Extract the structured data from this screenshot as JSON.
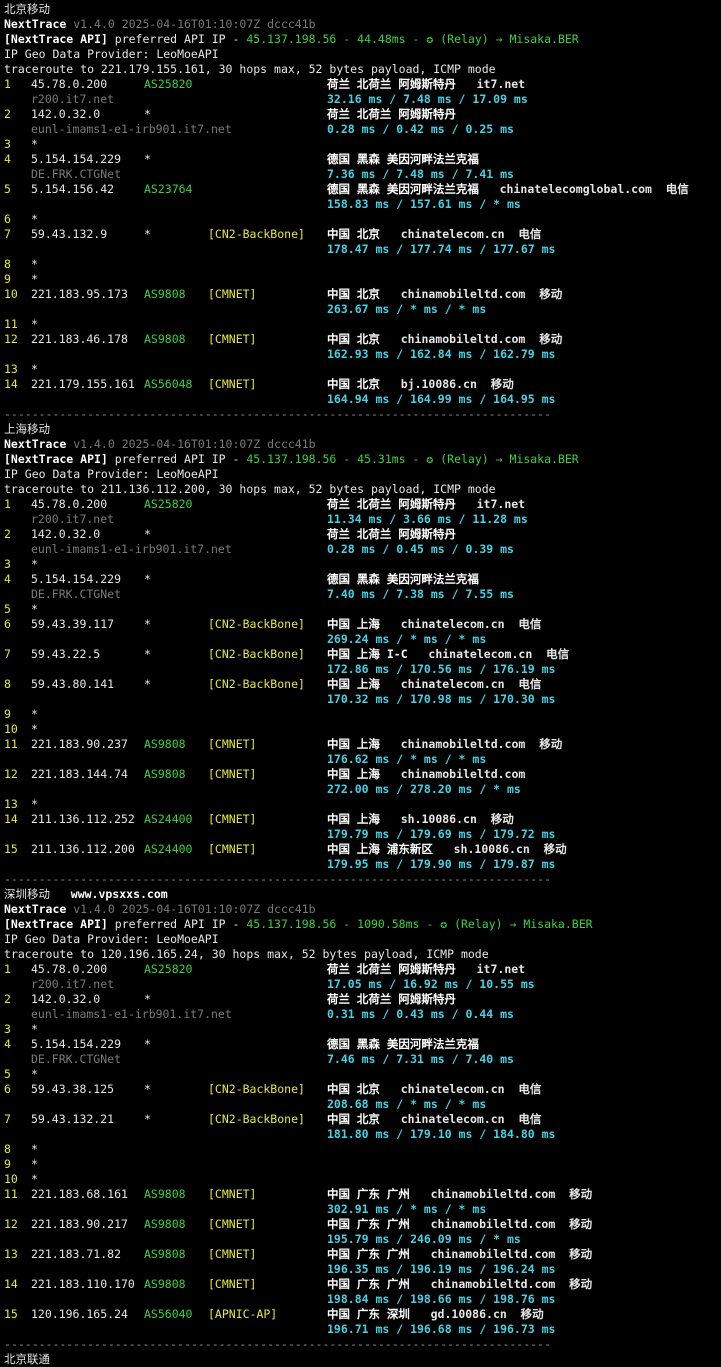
{
  "arrow": "→",
  "sections": [
    {
      "title": "北京移动",
      "header": {
        "app": "NextTrace",
        "version": "v1.4.0 2025-04-16T01:10:07Z dccc41b",
        "api_tag": "[NextTrace API]",
        "api_text": " preferred API IP - ",
        "api_ip": "45.137.198.56",
        "api_latency": "44.48ms",
        "relay_icon": "✪",
        "relay_text": "(Relay)",
        "relay_target": "Misaka.BER",
        "provider": "IP Geo Data Provider: LeoMoeAPI",
        "traceroute": "traceroute to 221.179.155.161, 30 hops max, 52 bytes payload, ICMP mode"
      },
      "hops": [
        {
          "n": "1",
          "ip": "45.78.0.200",
          "asn": "AS25820",
          "tag": "",
          "geo": "荷兰 北荷兰 阿姆斯特丹",
          "domain": "it7.net",
          "isp": "",
          "rdns": "r200.it7.net",
          "times": "32.16 ms / 7.48 ms / 17.09 ms"
        },
        {
          "n": "2",
          "ip": "142.0.32.0",
          "asn": "*",
          "tag": "",
          "geo": "荷兰 北荷兰 阿姆斯特丹",
          "domain": "",
          "isp": "",
          "rdns": "eunl-imams1-e1-irb901.it7.net",
          "times": "0.28 ms / 0.42 ms / 0.25 ms"
        },
        {
          "n": "3",
          "ip": "*",
          "asn": "",
          "tag": "",
          "geo": "",
          "domain": "",
          "isp": "",
          "rdns": "",
          "times": ""
        },
        {
          "n": "4",
          "ip": "5.154.154.229",
          "asn": "*",
          "tag": "",
          "geo": "德国 黑森 美因河畔法兰克福",
          "domain": "",
          "isp": "",
          "rdns": "DE.FRK.CTGNet",
          "times": "7.36 ms / 7.48 ms / 7.41 ms"
        },
        {
          "n": "5",
          "ip": "5.154.156.42",
          "asn": "AS23764",
          "tag": "",
          "geo": "德国 黑森 美因河畔法兰克福",
          "domain": "chinatelecomglobal.com",
          "isp": "电信",
          "rdns": "",
          "times": "158.83 ms / 157.61 ms / * ms"
        },
        {
          "n": "6",
          "ip": "*",
          "asn": "",
          "tag": "",
          "geo": "",
          "domain": "",
          "isp": "",
          "rdns": "",
          "times": ""
        },
        {
          "n": "7",
          "ip": "59.43.132.9",
          "asn": "*",
          "tag": "[CN2-BackBone]",
          "geo": "中国 北京",
          "domain": "chinatelecom.cn",
          "isp": "电信",
          "rdns": "",
          "times": "178.47 ms / 177.74 ms / 177.67 ms"
        },
        {
          "n": "8",
          "ip": "*",
          "asn": "",
          "tag": "",
          "geo": "",
          "domain": "",
          "isp": "",
          "rdns": "",
          "times": ""
        },
        {
          "n": "9",
          "ip": "*",
          "asn": "",
          "tag": "",
          "geo": "",
          "domain": "",
          "isp": "",
          "rdns": "",
          "times": ""
        },
        {
          "n": "10",
          "ip": "221.183.95.173",
          "asn": "AS9808",
          "tag": "[CMNET]",
          "geo": "中国 北京",
          "domain": "chinamobileltd.com",
          "isp": "移动",
          "rdns": "",
          "times": "263.67 ms / * ms / * ms"
        },
        {
          "n": "11",
          "ip": "*",
          "asn": "",
          "tag": "",
          "geo": "",
          "domain": "",
          "isp": "",
          "rdns": "",
          "times": ""
        },
        {
          "n": "12",
          "ip": "221.183.46.178",
          "asn": "AS9808",
          "tag": "[CMNET]",
          "geo": "中国 北京",
          "domain": "chinamobileltd.com",
          "isp": "移动",
          "rdns": "",
          "times": "162.93 ms / 162.84 ms / 162.79 ms"
        },
        {
          "n": "13",
          "ip": "*",
          "asn": "",
          "tag": "",
          "geo": "",
          "domain": "",
          "isp": "",
          "rdns": "",
          "times": ""
        },
        {
          "n": "14",
          "ip": "221.179.155.161",
          "asn": "AS56048",
          "tag": "[CMNET]",
          "geo": "中国 北京",
          "domain": "bj.10086.cn",
          "isp": "移动",
          "rdns": "",
          "times": "164.94 ms / 164.99 ms / 164.95 ms"
        }
      ]
    },
    {
      "title": "上海移动",
      "header": {
        "app": "NextTrace",
        "version": "v1.4.0 2025-04-16T01:10:07Z dccc41b",
        "api_tag": "[NextTrace API]",
        "api_text": " preferred API IP - ",
        "api_ip": "45.137.198.56",
        "api_latency": "45.31ms",
        "relay_icon": "✪",
        "relay_text": "(Relay)",
        "relay_target": "Misaka.BER",
        "provider": "IP Geo Data Provider: LeoMoeAPI",
        "traceroute": "traceroute to 211.136.112.200, 30 hops max, 52 bytes payload, ICMP mode"
      },
      "hops": [
        {
          "n": "1",
          "ip": "45.78.0.200",
          "asn": "AS25820",
          "tag": "",
          "geo": "荷兰 北荷兰 阿姆斯特丹",
          "domain": "it7.net",
          "isp": "",
          "rdns": "r200.it7.net",
          "times": "11.34 ms / 3.66 ms / 11.28 ms"
        },
        {
          "n": "2",
          "ip": "142.0.32.0",
          "asn": "*",
          "tag": "",
          "geo": "荷兰 北荷兰 阿姆斯特丹",
          "domain": "",
          "isp": "",
          "rdns": "eunl-imams1-e1-irb901.it7.net",
          "times": "0.28 ms / 0.45 ms / 0.39 ms"
        },
        {
          "n": "3",
          "ip": "*",
          "asn": "",
          "tag": "",
          "geo": "",
          "domain": "",
          "isp": "",
          "rdns": "",
          "times": ""
        },
        {
          "n": "4",
          "ip": "5.154.154.229",
          "asn": "*",
          "tag": "",
          "geo": "德国 黑森 美因河畔法兰克福",
          "domain": "",
          "isp": "",
          "rdns": "DE.FRK.CTGNet",
          "times": "7.40 ms / 7.38 ms / 7.55 ms"
        },
        {
          "n": "5",
          "ip": "*",
          "asn": "",
          "tag": "",
          "geo": "",
          "domain": "",
          "isp": "",
          "rdns": "",
          "times": ""
        },
        {
          "n": "6",
          "ip": "59.43.39.117",
          "asn": "*",
          "tag": "[CN2-BackBone]",
          "geo": "中国 上海",
          "domain": "chinatelecom.cn",
          "isp": "电信",
          "rdns": "",
          "times": "269.24 ms / * ms / * ms"
        },
        {
          "n": "7",
          "ip": "59.43.22.5",
          "asn": "*",
          "tag": "[CN2-BackBone]",
          "geo": "中国 上海 I-C",
          "domain": "chinatelecom.cn",
          "isp": "电信",
          "rdns": "",
          "times": "172.86 ms / 170.56 ms / 176.19 ms"
        },
        {
          "n": "8",
          "ip": "59.43.80.141",
          "asn": "*",
          "tag": "[CN2-BackBone]",
          "geo": "中国 上海",
          "domain": "chinatelecom.cn",
          "isp": "电信",
          "rdns": "",
          "times": "170.32 ms / 170.98 ms / 170.30 ms"
        },
        {
          "n": "9",
          "ip": "*",
          "asn": "",
          "tag": "",
          "geo": "",
          "domain": "",
          "isp": "",
          "rdns": "",
          "times": ""
        },
        {
          "n": "10",
          "ip": "*",
          "asn": "",
          "tag": "",
          "geo": "",
          "domain": "",
          "isp": "",
          "rdns": "",
          "times": ""
        },
        {
          "n": "11",
          "ip": "221.183.90.237",
          "asn": "AS9808",
          "tag": "[CMNET]",
          "geo": "中国 上海",
          "domain": "chinamobileltd.com",
          "isp": "移动",
          "rdns": "",
          "times": "176.62 ms / * ms / * ms"
        },
        {
          "n": "12",
          "ip": "221.183.144.74",
          "asn": "AS9808",
          "tag": "[CMNET]",
          "geo": "中国 上海",
          "domain": "chinamobileltd.com",
          "isp": "",
          "rdns": "",
          "times": "272.00 ms / 278.20 ms / * ms"
        },
        {
          "n": "13",
          "ip": "*",
          "asn": "",
          "tag": "",
          "geo": "",
          "domain": "",
          "isp": "",
          "rdns": "",
          "times": ""
        },
        {
          "n": "14",
          "ip": "211.136.112.252",
          "asn": "AS24400",
          "tag": "[CMNET]",
          "geo": "中国 上海",
          "domain": "sh.10086.cn",
          "isp": "移动",
          "rdns": "",
          "times": "179.79 ms / 179.69 ms / 179.72 ms"
        },
        {
          "n": "15",
          "ip": "211.136.112.200",
          "asn": "AS24400",
          "tag": "[CMNET]",
          "geo": "中国 上海 浦东新区",
          "domain": "sh.10086.cn",
          "isp": "移动",
          "rdns": "",
          "times": "179.95 ms / 179.90 ms / 179.87 ms"
        }
      ]
    },
    {
      "title": "深圳移动",
      "watermark": "www.vpsxxs.com",
      "header": {
        "app": "NextTrace",
        "version": "v1.4.0 2025-04-16T01:10:07Z dccc41b",
        "api_tag": "[NextTrace API]",
        "api_text": " preferred API IP - ",
        "api_ip": "45.137.198.56",
        "api_latency": "1090.58ms",
        "relay_icon": "✪",
        "relay_text": "(Relay)",
        "relay_target": "Misaka.BER",
        "provider": "IP Geo Data Provider: LeoMoeAPI",
        "traceroute": "traceroute to 120.196.165.24, 30 hops max, 52 bytes payload, ICMP mode"
      },
      "hops": [
        {
          "n": "1",
          "ip": "45.78.0.200",
          "asn": "AS25820",
          "tag": "",
          "geo": "荷兰 北荷兰 阿姆斯特丹",
          "domain": "it7.net",
          "isp": "",
          "rdns": "r200.it7.net",
          "times": "17.05 ms / 16.92 ms / 10.55 ms"
        },
        {
          "n": "2",
          "ip": "142.0.32.0",
          "asn": "*",
          "tag": "",
          "geo": "荷兰 北荷兰 阿姆斯特丹",
          "domain": "",
          "isp": "",
          "rdns": "eunl-imams1-e1-irb901.it7.net",
          "times": "0.31 ms / 0.43 ms / 0.44 ms"
        },
        {
          "n": "3",
          "ip": "*",
          "asn": "",
          "tag": "",
          "geo": "",
          "domain": "",
          "isp": "",
          "rdns": "",
          "times": ""
        },
        {
          "n": "4",
          "ip": "5.154.154.229",
          "asn": "*",
          "tag": "",
          "geo": "德国 黑森 美因河畔法兰克福",
          "domain": "",
          "isp": "",
          "rdns": "DE.FRK.CTGNet",
          "times": "7.46 ms / 7.31 ms / 7.40 ms"
        },
        {
          "n": "5",
          "ip": "*",
          "asn": "",
          "tag": "",
          "geo": "",
          "domain": "",
          "isp": "",
          "rdns": "",
          "times": ""
        },
        {
          "n": "6",
          "ip": "59.43.38.125",
          "asn": "*",
          "tag": "[CN2-BackBone]",
          "geo": "中国 北京",
          "domain": "chinatelecom.cn",
          "isp": "电信",
          "rdns": "",
          "times": "208.68 ms / * ms / * ms"
        },
        {
          "n": "7",
          "ip": "59.43.132.21",
          "asn": "*",
          "tag": "[CN2-BackBone]",
          "geo": "中国 北京",
          "domain": "chinatelecom.cn",
          "isp": "电信",
          "rdns": "",
          "times": "181.80 ms / 179.10 ms / 184.80 ms"
        },
        {
          "n": "8",
          "ip": "*",
          "asn": "",
          "tag": "",
          "geo": "",
          "domain": "",
          "isp": "",
          "rdns": "",
          "times": ""
        },
        {
          "n": "9",
          "ip": "*",
          "asn": "",
          "tag": "",
          "geo": "",
          "domain": "",
          "isp": "",
          "rdns": "",
          "times": ""
        },
        {
          "n": "10",
          "ip": "*",
          "asn": "",
          "tag": "",
          "geo": "",
          "domain": "",
          "isp": "",
          "rdns": "",
          "times": ""
        },
        {
          "n": "11",
          "ip": "221.183.68.161",
          "asn": "AS9808",
          "tag": "[CMNET]",
          "geo": "中国 广东 广州",
          "domain": "chinamobileltd.com",
          "isp": "移动",
          "rdns": "",
          "times": "302.91 ms / * ms / * ms"
        },
        {
          "n": "12",
          "ip": "221.183.90.217",
          "asn": "AS9808",
          "tag": "[CMNET]",
          "geo": "中国 广东 广州",
          "domain": "chinamobileltd.com",
          "isp": "移动",
          "rdns": "",
          "times": "195.79 ms / 246.09 ms / * ms"
        },
        {
          "n": "13",
          "ip": "221.183.71.82",
          "asn": "AS9808",
          "tag": "[CMNET]",
          "geo": "中国 广东 广州",
          "domain": "chinamobileltd.com",
          "isp": "移动",
          "rdns": "",
          "times": "196.35 ms / 196.19 ms / 196.24 ms"
        },
        {
          "n": "14",
          "ip": "221.183.110.170",
          "asn": "AS9808",
          "tag": "[CMNET]",
          "geo": "中国 广东 广州",
          "domain": "chinamobileltd.com",
          "isp": "移动",
          "rdns": "",
          "times": "198.84 ms / 198.66 ms / 198.76 ms"
        },
        {
          "n": "15",
          "ip": "120.196.165.24",
          "asn": "AS56040",
          "tag": "[APNIC-AP]",
          "geo": "中国 广东 深圳",
          "domain": "gd.10086.cn",
          "isp": "移动",
          "rdns": "",
          "times": "196.71 ms / 196.68 ms / 196.73 ms"
        }
      ]
    }
  ],
  "separator": "-------------------------------------------------------------------------------",
  "footer_title": "北京联通"
}
